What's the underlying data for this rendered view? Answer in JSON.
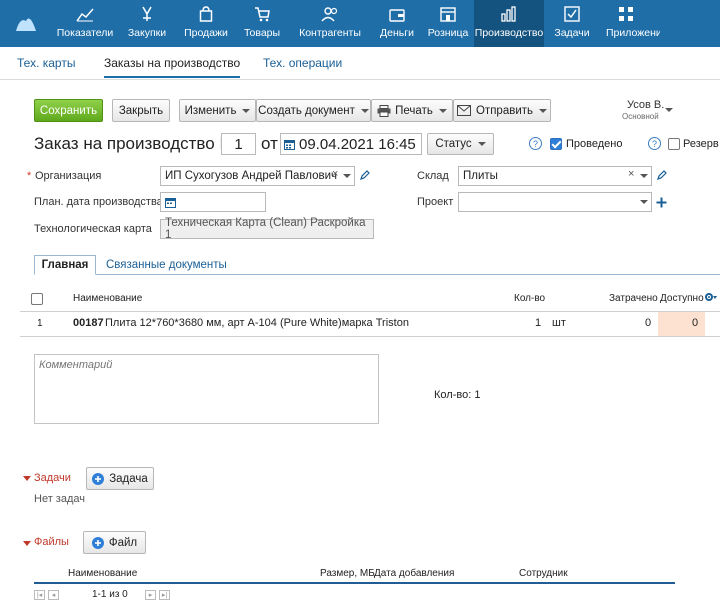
{
  "nav": {
    "items": [
      {
        "label": "Показатели",
        "icon": "chart-icon"
      },
      {
        "label": "Закупки",
        "icon": "purchases-icon"
      },
      {
        "label": "Продажи",
        "icon": "bag-icon"
      },
      {
        "label": "Товары",
        "icon": "cart-icon"
      },
      {
        "label": "Контрагенты",
        "icon": "users-icon"
      },
      {
        "label": "Деньги",
        "icon": "wallet-icon"
      },
      {
        "label": "Розница",
        "icon": "store-icon"
      },
      {
        "label": "Производство",
        "icon": "production-icon"
      },
      {
        "label": "Задачи",
        "icon": "tasks-icon"
      },
      {
        "label": "Приложения",
        "icon": "apps-icon"
      }
    ],
    "active": "Производство"
  },
  "subtabs": [
    "Тех. карты",
    "Заказы на производство",
    "Тех. операции"
  ],
  "toolbar": {
    "save": "Сохранить",
    "close": "Закрыть",
    "edit": "Изменить",
    "create_doc": "Создать документ",
    "print": "Печать",
    "send": "Отправить"
  },
  "user": {
    "name": "Усов В.",
    "role": "Основной"
  },
  "doc": {
    "title": "Заказ на производство №",
    "number": "1",
    "from": "от",
    "date": "09.04.2021 16:45",
    "status": "Статус",
    "posted_label": "Проведено",
    "reserve_label": "Резерв",
    "help": "?"
  },
  "fields": {
    "org_label": "Организация",
    "org_required": "*",
    "org_value": "ИП Сухогузов Андрей Павлович",
    "plan_date_label": "План. дата производства",
    "techcard_label": "Технологическая карта",
    "techcard_value": "Техническая Карта (Clean) Раскройка 1",
    "warehouse_label": "Склад",
    "warehouse_value": "Плиты",
    "project_label": "Проект",
    "clear": "×"
  },
  "tabs": {
    "main": "Главная",
    "related": "Связанные документы"
  },
  "table": {
    "columns": {
      "name": "Наименование",
      "qty": "Кол-во",
      "spent": "Затрачено",
      "available": "Доступно"
    },
    "rows": [
      {
        "num": "1",
        "code": "00187",
        "name": "Плита 12*760*3680 мм, арт А-104 (Pure White)марка Triston",
        "qty": "1",
        "unit": "шт",
        "spent": "0",
        "available": "0"
      }
    ]
  },
  "comment_placeholder": "Комментарий",
  "qty_total": "Кол-во: 1",
  "tasks": {
    "label": "Задачи",
    "button": "Задача",
    "empty": "Нет задач"
  },
  "files": {
    "label": "Файлы",
    "button": "Файл",
    "columns": {
      "name": "Наименование",
      "size": "Размер, МБ",
      "date": "Дата добавления",
      "employee": "Сотрудник"
    },
    "pager": "1-1 из 0"
  }
}
